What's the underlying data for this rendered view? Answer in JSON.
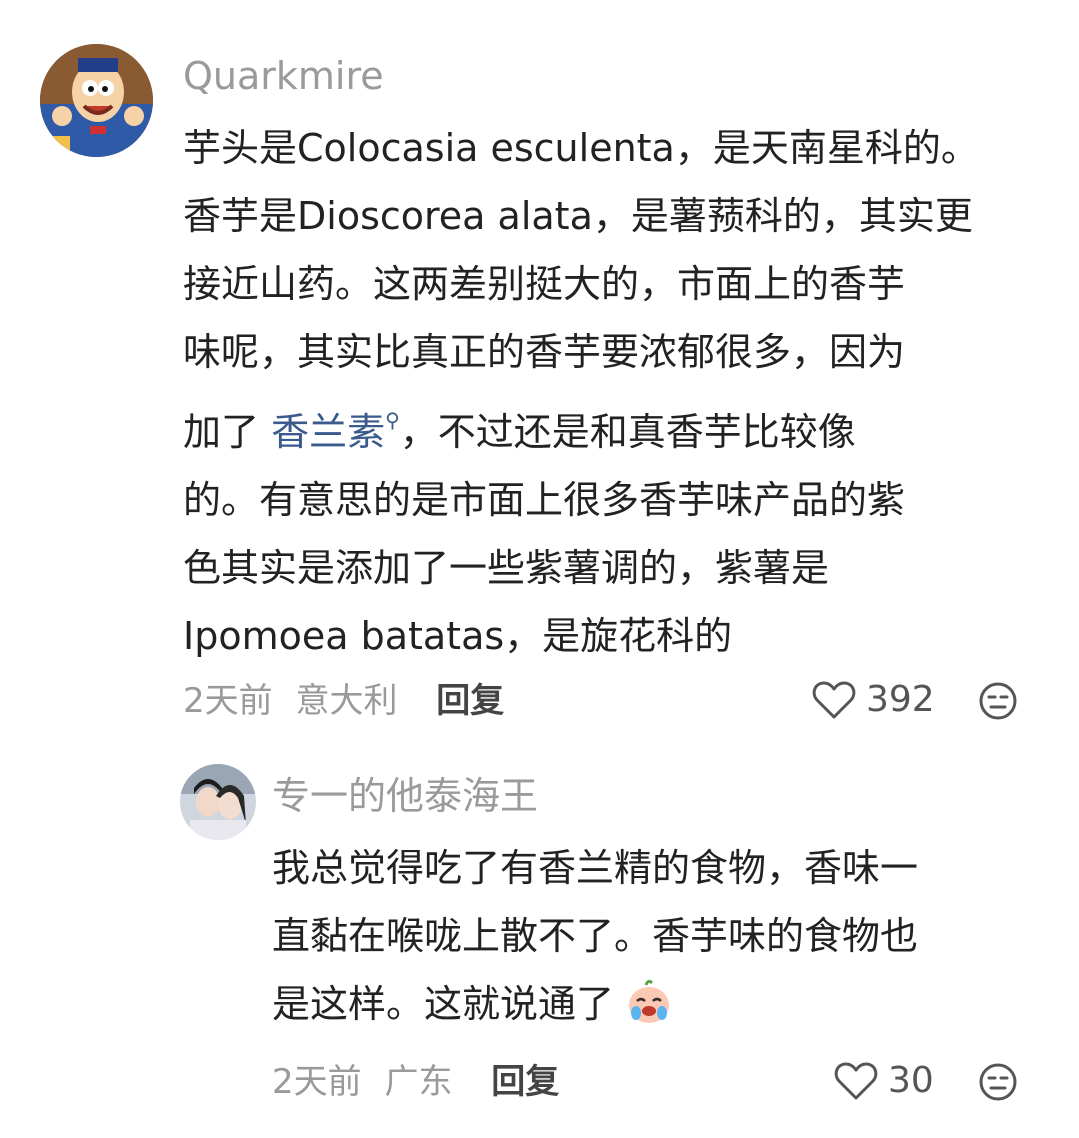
{
  "comments": [
    {
      "username": "Quarkmire",
      "body_lines": [
        "芋头是Colocasia esculenta，是天南星科的。",
        "香芋是Dioscorea alata，是薯蓣科的，其实更",
        "接近山药。这两差别挺大的，市面上的香芋",
        "味呢，其实比真正的香芋要浓郁很多，因为"
      ],
      "line5_prefix": "加了 ",
      "line5_link": "香兰素",
      "line5_suffix": "，不过还是和真香芋比较像",
      "body_lines_after": [
        "的。有意思的是市面上很多香芋味产品的紫",
        "色其实是添加了一些紫薯调的，紫薯是",
        "Ipomoea batatas，是旋花科的"
      ],
      "time": "2天前",
      "location": "意大利",
      "reply_label": "回复",
      "likes": "392"
    },
    {
      "username": "专一的他泰海王",
      "body_lines": [
        "我总觉得吃了有香兰精的食物，香味一",
        "直黏在喉咙上散不了。香芋味的食物也",
        "是这样。这就说通了"
      ],
      "time": "2天前",
      "location": "广东",
      "reply_label": "回复",
      "likes": "30"
    }
  ]
}
